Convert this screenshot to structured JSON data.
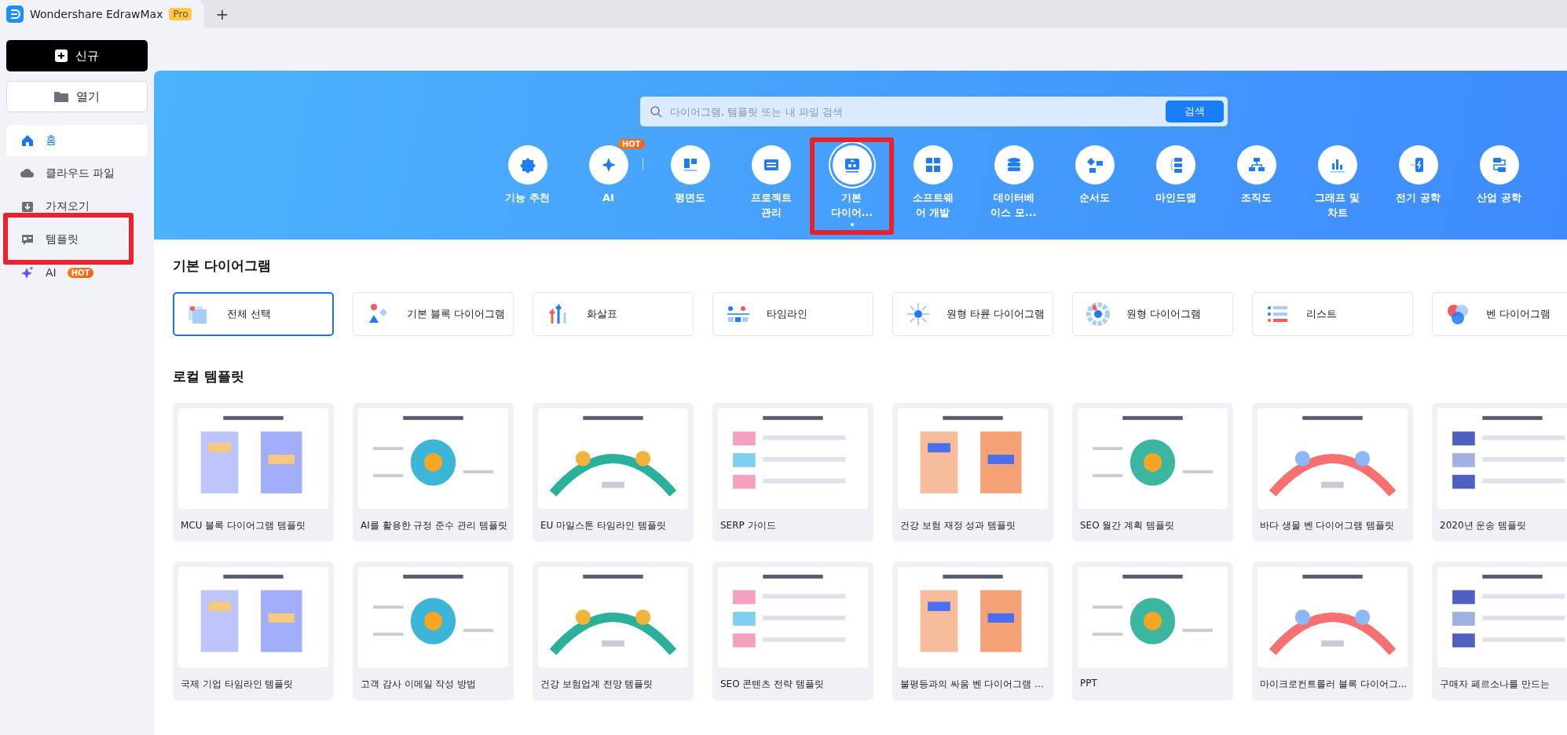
{
  "app": {
    "title": "Wondershare EdrawMax",
    "badge": "Pro",
    "new_tab": "+"
  },
  "sidebar": {
    "new_button": "신규",
    "open_button": "열기",
    "items": [
      {
        "label": "홈",
        "selected": true,
        "highlighted": false
      },
      {
        "label": "클라우드 파일",
        "selected": false,
        "highlighted": false
      },
      {
        "label": "가져오기",
        "selected": false,
        "highlighted": false
      },
      {
        "label": "템플릿",
        "selected": false,
        "highlighted": true
      },
      {
        "label": "AI",
        "badge": "HOT",
        "selected": false,
        "highlighted": false
      }
    ]
  },
  "banner": {
    "search": {
      "placeholder": "다이어그램, 템플릿 또는 내 파일 검색",
      "button": "검색"
    },
    "categories": [
      {
        "label": "기능 추천",
        "selected": false,
        "highlighted": false
      },
      {
        "label": "AI",
        "badge": "HOT",
        "selected": false,
        "highlighted": false
      },
      {
        "label": "평면도",
        "selected": false,
        "highlighted": false
      },
      {
        "label": "프로젝트\n관리",
        "selected": false,
        "highlighted": false
      },
      {
        "label": "기본\n다이어...",
        "selected": true,
        "highlighted": true
      },
      {
        "label": "소프트웨\n어 개발",
        "selected": false,
        "highlighted": false
      },
      {
        "label": "데이터베\n이스 모...",
        "selected": false,
        "highlighted": false
      },
      {
        "label": "순서도",
        "selected": false,
        "highlighted": false
      },
      {
        "label": "마인드맵",
        "selected": false,
        "highlighted": false
      },
      {
        "label": "조직도",
        "selected": false,
        "highlighted": false
      },
      {
        "label": "그래프 및\n차트",
        "selected": false,
        "highlighted": false
      },
      {
        "label": "전기 공학",
        "selected": false,
        "highlighted": false
      },
      {
        "label": "산업 공학",
        "selected": false,
        "highlighted": false
      }
    ]
  },
  "basic_section": {
    "title": "기본 다이어그램",
    "types": [
      {
        "label": "전체 선택",
        "selected": true
      },
      {
        "label": "기본 블록 다이어그램",
        "selected": false
      },
      {
        "label": "화살표",
        "selected": false
      },
      {
        "label": "타임라인",
        "selected": false
      },
      {
        "label": "원형 타륜 다이어그램",
        "selected": false
      },
      {
        "label": "원형 다이어그램",
        "selected": false
      },
      {
        "label": "리스트",
        "selected": false
      },
      {
        "label": "벤 다이어그램",
        "selected": false
      }
    ]
  },
  "local_templates": {
    "title": "로컬 템플릿",
    "templates": [
      {
        "name": "MCU 블록 다이어그램 템플릿"
      },
      {
        "name": "AI를 활용한 규정 준수 관리 템플릿"
      },
      {
        "name": "EU 마일스톤 타임라인 템플릿"
      },
      {
        "name": "SERP 가이드"
      },
      {
        "name": "건강 보험 재정 성과 템플릿"
      },
      {
        "name": "SEO 월간 계획 템플릿"
      },
      {
        "name": "바다 생물 벤 다이어그램 템플릿"
      },
      {
        "name": "2020년 운송 템플릿"
      },
      {
        "name": "국제 기업 타임라인 템플릿"
      },
      {
        "name": "고객 감사 이메일 작성 방법"
      },
      {
        "name": "건강 보험업계 전망 템플릿"
      },
      {
        "name": "SEO 콘텐츠 전략 템플릿"
      },
      {
        "name": "불평등과의 싸움 벤 다이어그램 ..."
      },
      {
        "name": "PPT"
      },
      {
        "name": "마이크로컨트롤러 블록 다이어그..."
      },
      {
        "name": "구매자 페르소나를 만드는"
      }
    ]
  }
}
